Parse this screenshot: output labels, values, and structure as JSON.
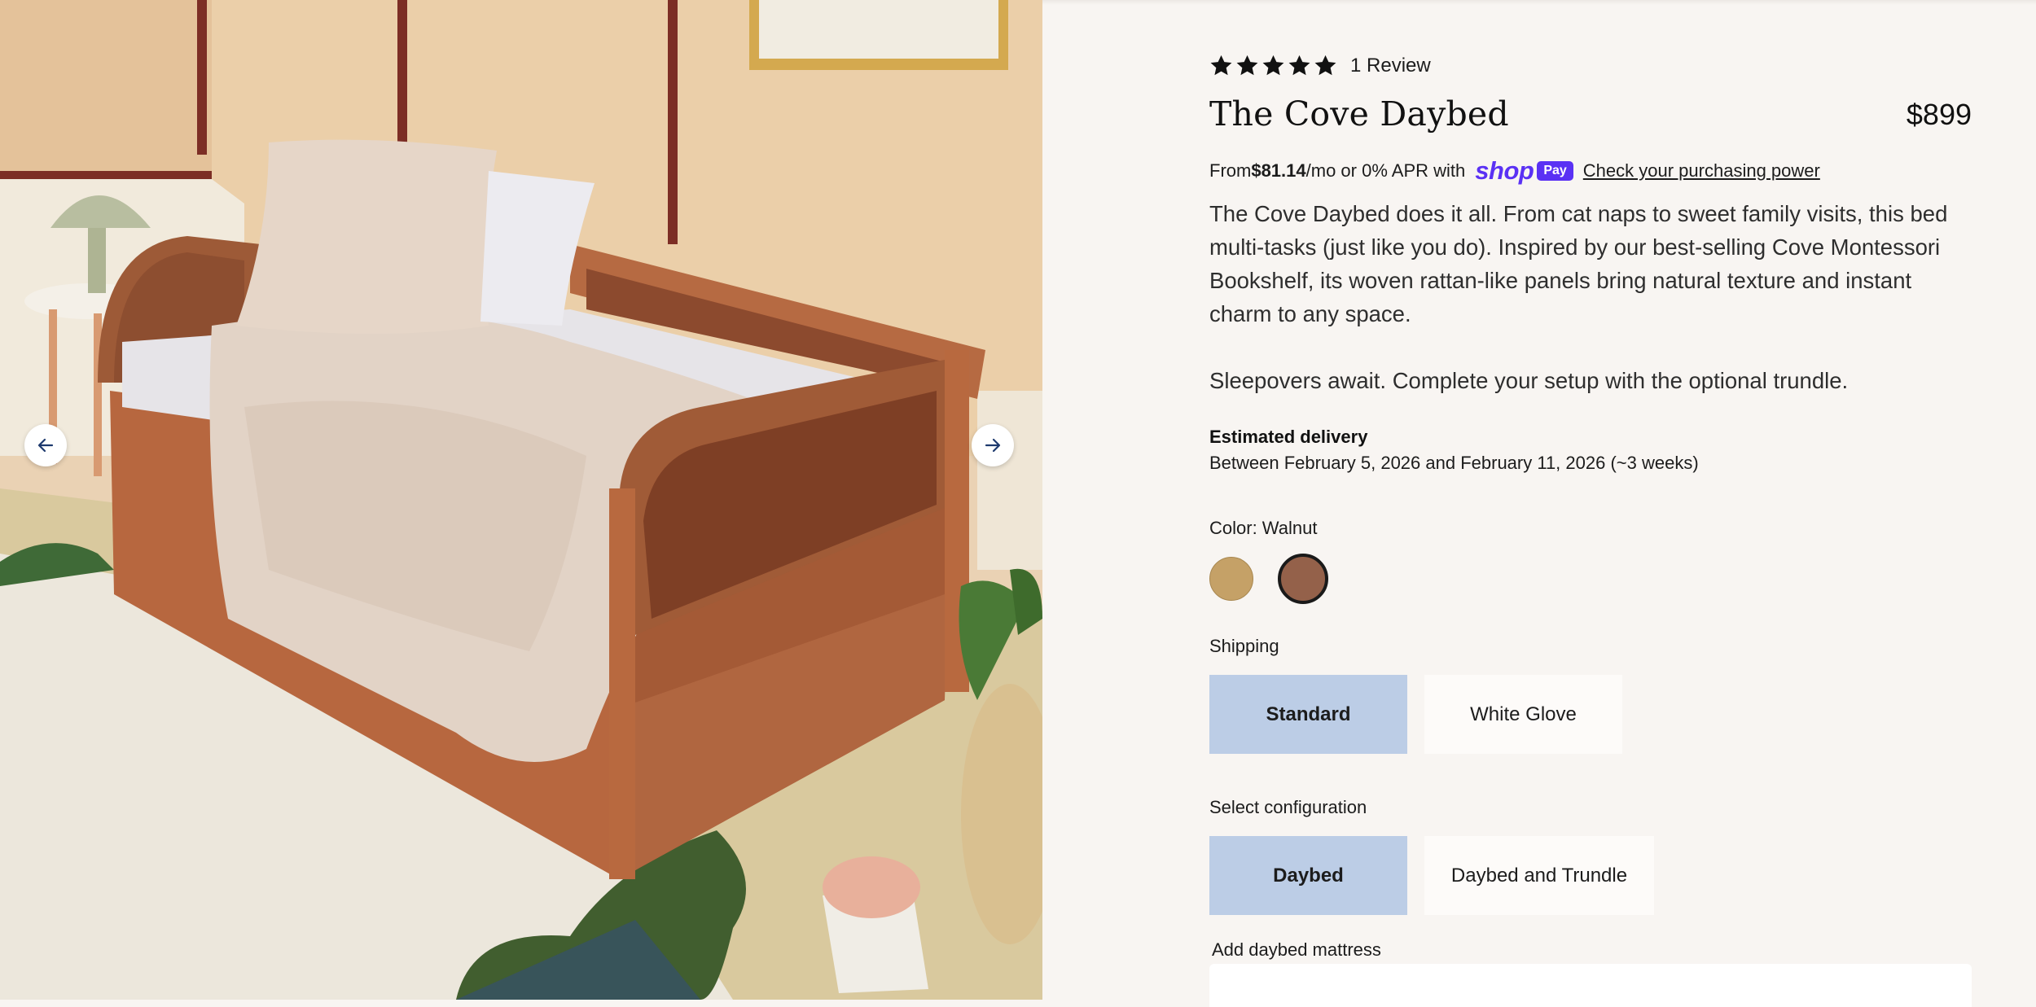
{
  "gallery": {
    "image_alt": "The Cove Daybed in Walnut styled in a child's bedroom",
    "prev_icon": "arrow-left-icon",
    "next_icon": "arrow-right-icon"
  },
  "product": {
    "rating_stars": 5,
    "review_count": "1 Review",
    "title": "The Cove Daybed",
    "price": "$899",
    "financing": {
      "prefix": "From ",
      "amount": "$81.14",
      "suffix": "/mo or 0% APR with",
      "shop_logo": "shop",
      "pay_badge": "Pay",
      "link": "Check your purchasing power"
    },
    "description": [
      "The Cove Daybed does it all. From cat naps to sweet family visits, this bed multi-tasks (just like you do). Inspired by our best-selling Cove Montessori Bookshelf, its woven rattan-like panels bring natural texture and instant charm to any space.",
      "Sleepovers await. Complete your setup with the optional trundle."
    ],
    "delivery": {
      "label": "Estimated delivery",
      "text": "Between February 5, 2026 and February 11, 2026 (~3 weeks)"
    },
    "color": {
      "label": "Color: Walnut",
      "options": [
        {
          "name": "Natural",
          "hex": "#c5a167",
          "selected": false
        },
        {
          "name": "Walnut",
          "hex": "#94614a",
          "selected": true
        }
      ]
    },
    "shipping": {
      "label": "Shipping",
      "options": [
        {
          "label": "Standard",
          "selected": true
        },
        {
          "label": "White Glove",
          "selected": false
        }
      ]
    },
    "configuration": {
      "label": "Select configuration",
      "options": [
        {
          "label": "Daybed",
          "selected": true
        },
        {
          "label": "Daybed and Trundle",
          "selected": false
        }
      ]
    },
    "mattress": {
      "label": "Add daybed mattress"
    }
  },
  "colors": {
    "selected_option": "#bccde6",
    "unselected_option": "#fdfbf9",
    "shop_pay_purple": "#5a31f4",
    "page_background": "#f8f5f2"
  }
}
